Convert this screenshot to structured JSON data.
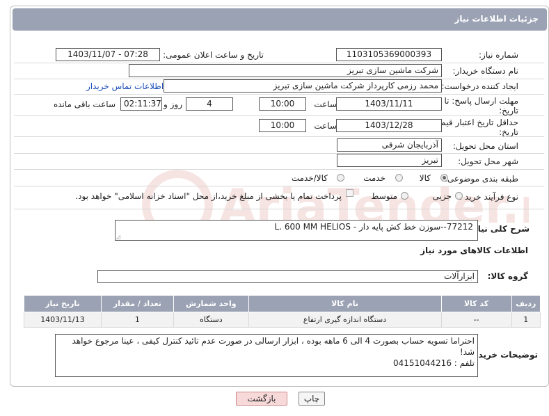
{
  "header": {
    "title": "جزئیات اطلاعات نیاز"
  },
  "form": {
    "need_number_label": "شماره نیاز:",
    "need_number": "1103105369000393",
    "announce_label": "تاریخ و ساعت اعلان عمومی:",
    "announce_value": "1403/11/07 - 07:28",
    "buyer_org_label": "نام دستگاه خریدار:",
    "buyer_org": "شرکت ماشین سازی تبریز",
    "creator_label": "ایجاد کننده درخواست:",
    "creator": "محمد رزمی کارپرداز شرکت ماشین سازی تبریز",
    "buyer_contact_link": "اطلاعات تماس خریدار",
    "reply_deadline_label_1": "مهلت ارسال پاسخ: تا",
    "reply_deadline_label_2": "تاریخ:",
    "reply_date": "1403/11/11",
    "time_label": "ساعت",
    "reply_time": "10:00",
    "days_value": "4",
    "days_label": "روز و",
    "remaining_time": "02:11:37",
    "remaining_label": "ساعت باقی مانده",
    "price_validity_label_1": "حداقل تاریخ اعتبار قیمت: تا",
    "price_validity_label_2": "تاریخ:",
    "price_date": "1403/12/28",
    "price_time": "10:00",
    "province_label": "استان محل تحویل:",
    "province": "آذربایجان شرقی",
    "city_label": "شهر محل تحویل:",
    "city": "تبریز",
    "category_label": "طبقه بندی موضوعی:",
    "category_options": [
      "کالا",
      "خدمت",
      "کالا/خدمت"
    ],
    "process_label": "نوع فرآیند خرید :",
    "process_options": [
      "جزیی",
      "متوسط"
    ],
    "payment_note": "پرداخت تمام یا بخشی از مبلغ خرید،از محل \"اسناد خزانه اسلامی\" خواهد بود.",
    "need_desc_label": "شرح کلی نیاز:",
    "need_desc": "77212--سوزن خط کش پایه دار - L. 600  MM HELIOS"
  },
  "goods": {
    "section_title": "اطلاعات کالاهای مورد نیاز",
    "group_label": "گروه کالا:",
    "group_value": "ابزارآلات",
    "columns": [
      "ردیف",
      "کد کالا",
      "نام کالا",
      "واحد شمارش",
      "تعداد / مقدار",
      "تاریخ نیاز"
    ],
    "rows": [
      [
        "1",
        "--",
        "دستگاه اندازه گیری ارتفاع",
        "دستگاه",
        "1",
        "1403/11/13"
      ]
    ]
  },
  "buyer_notes": {
    "label": "توضیحات خریدار:",
    "line1": "احتراما تسویه حساب بصورت 4 الی 6 ماهه بوده ، ابزار ارسالی در صورت عدم تائید کنترل کیفی ، عینا مرجوع خواهد شد!",
    "line2": "تلفم : 04151044216"
  },
  "buttons": {
    "print": "چاپ",
    "return": "بازگشت"
  },
  "watermark": {
    "text": "AriaTender.neT"
  },
  "colors": {
    "header_bg": "#9aa2b3",
    "link": "#1e4fb8",
    "return_btn": "#f7d9d9"
  }
}
